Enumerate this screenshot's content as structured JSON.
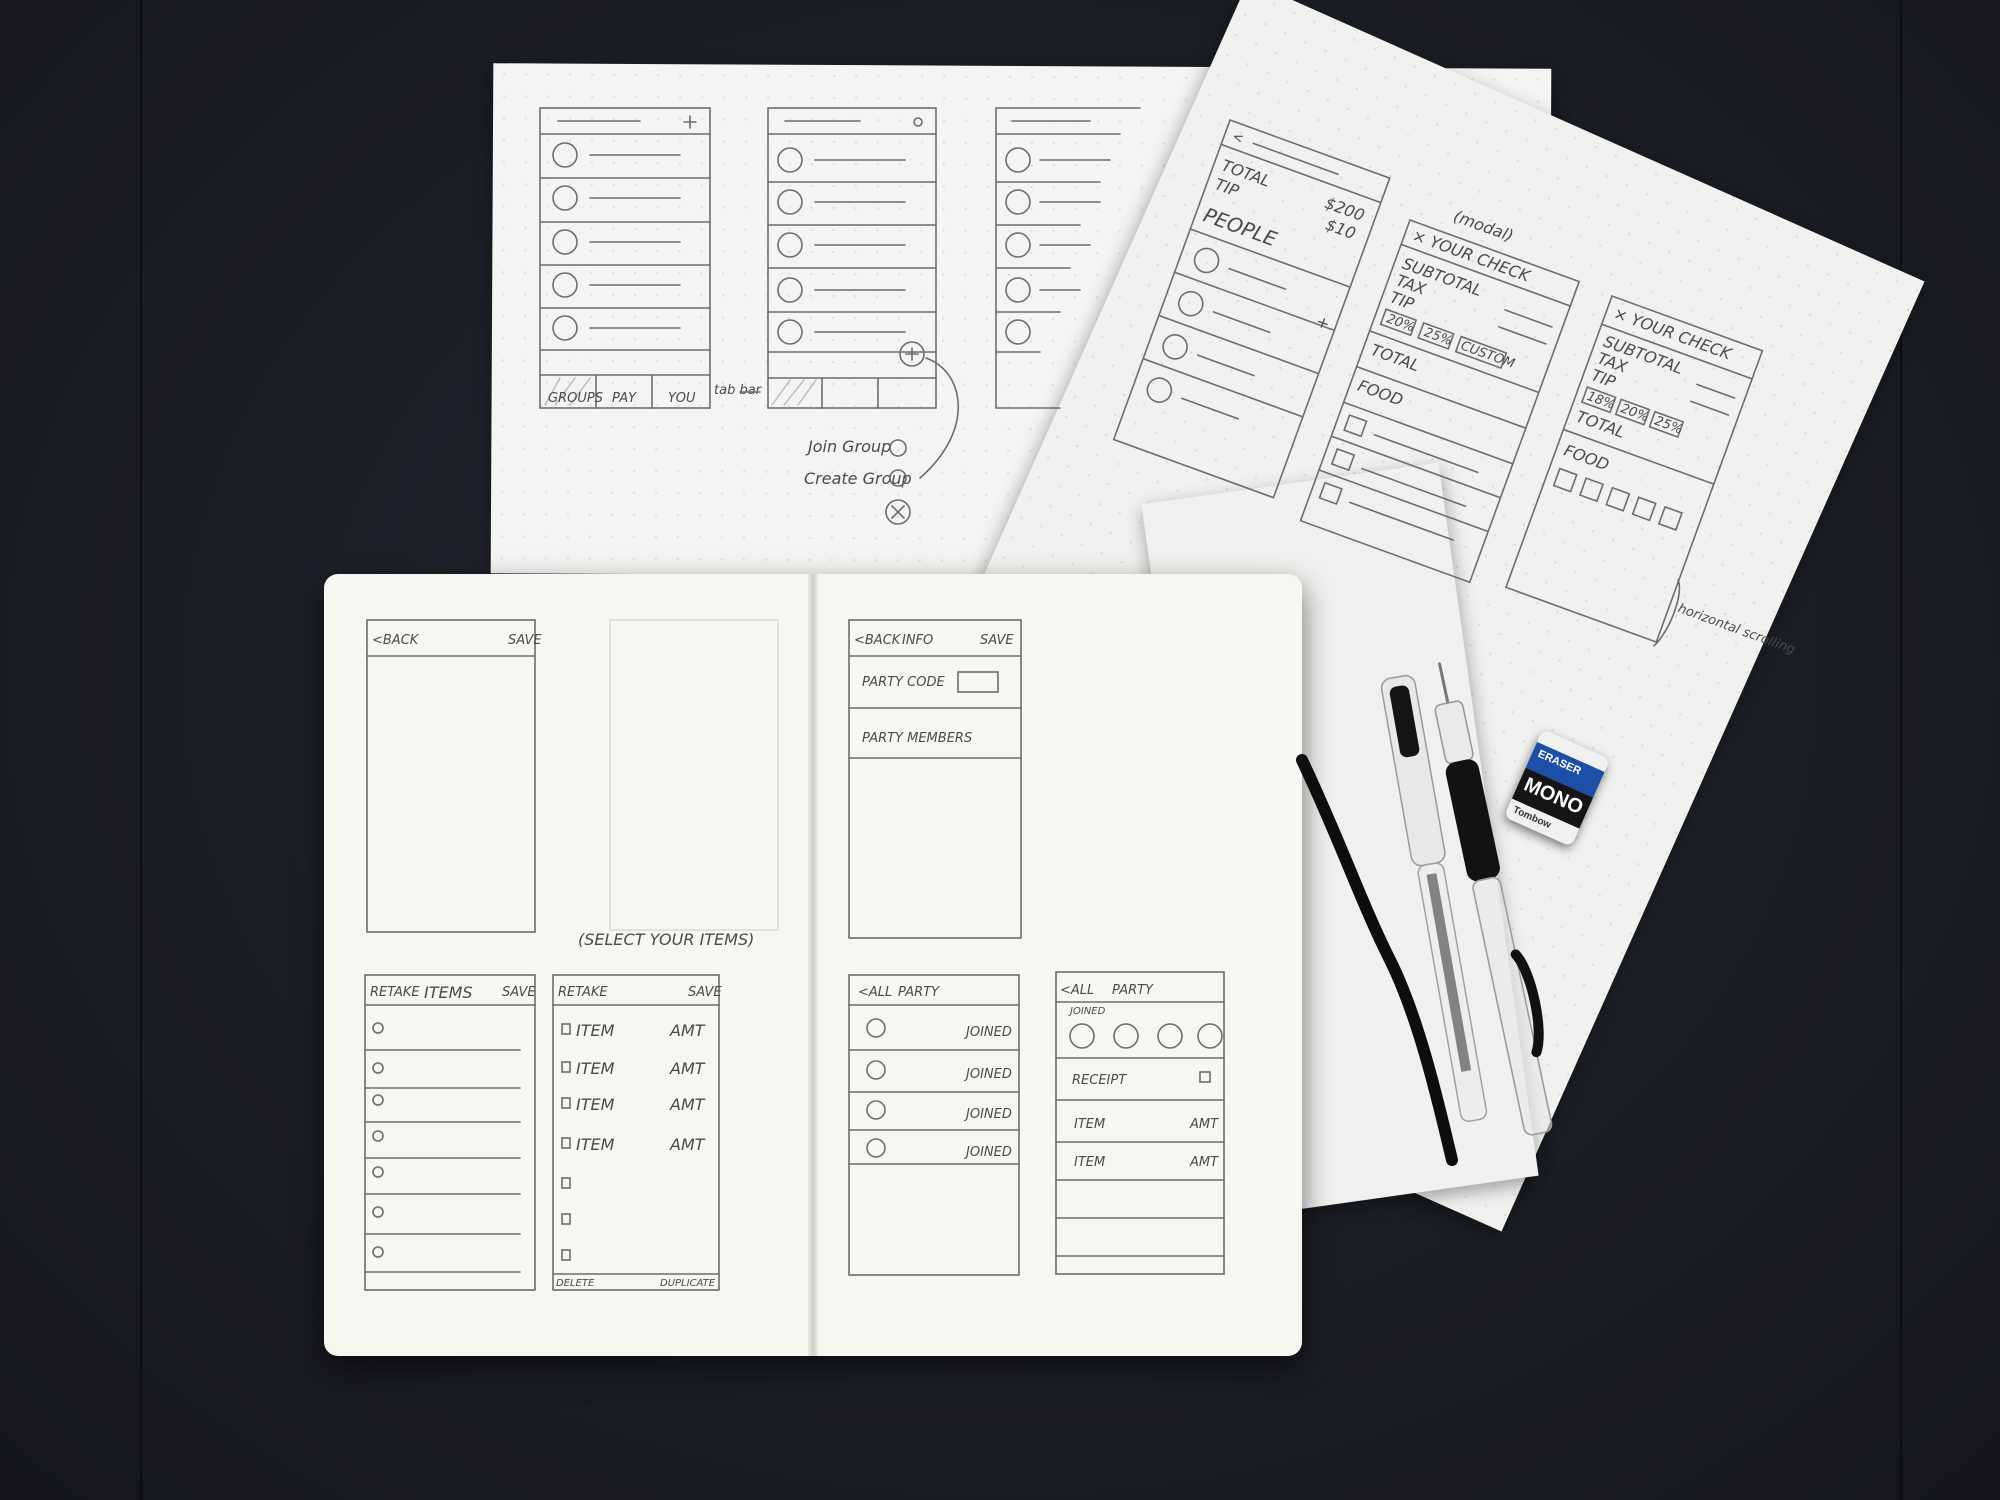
{
  "sheet_top": {
    "screen1_tabs": [
      "GROUPS",
      "PAY",
      "YOU"
    ],
    "tab_note": "tab bar",
    "menu_items": [
      "Join Group",
      "Create Group"
    ]
  },
  "sheet_right": {
    "labels": {
      "total": "TOTAL",
      "tip": "TIP",
      "people": "PEOPLE"
    },
    "values": [
      "$200",
      "$10"
    ],
    "modal_note": "(modal)",
    "check_title": "× YOUR CHECK",
    "check_fields": [
      "SUBTOTAL",
      "TAX",
      "TIP"
    ],
    "tip_options": [
      "20%",
      "25%",
      "CUSTOM"
    ],
    "total_label": "TOTAL",
    "food_label": "FOOD",
    "check2_title": "× YOUR CHECK",
    "check2_fields": [
      "SUBTOTAL",
      "TAX",
      "TIP"
    ],
    "check2_tips": [
      "18%",
      "20%",
      "25%"
    ],
    "check2_total": "TOTAL",
    "check2_food": "FOOD",
    "scroll_note": "horizontal scrolling"
  },
  "notebook": {
    "s1": {
      "back": "<BACK",
      "save": "SAVE"
    },
    "note": "(SELECT YOUR ITEMS)",
    "s2": {
      "left": "RETAKE",
      "title": "ITEMS",
      "right": "SAVE"
    },
    "s3": {
      "left": "RETAKE",
      "right": "SAVE",
      "rows": [
        [
          "ITEM",
          "AMT"
        ],
        [
          "ITEM",
          "AMT"
        ],
        [
          "ITEM",
          "AMT"
        ],
        [
          "ITEM",
          "AMT"
        ]
      ],
      "delete": "DELETE",
      "duplicate": "DUPLICATE"
    },
    "s4": {
      "back": "<BACK",
      "title": "INFO",
      "save": "SAVE",
      "code": "PARTY CODE",
      "members": "PARTY MEMBERS"
    },
    "s5": {
      "back": "<ALL",
      "title": "PARTY",
      "status": [
        "JOINED",
        "JOINED",
        "JOINED",
        "JOINED"
      ]
    },
    "s6": {
      "back": "<ALL",
      "title": "PARTY",
      "joined": "JOINED",
      "receipt": "RECEIPT",
      "rows": [
        [
          "ITEM",
          "AMT"
        ],
        [
          "ITEM",
          "AMT"
        ]
      ]
    }
  },
  "eraser": {
    "brand": "Tombow",
    "line1": "MONO",
    "line2": "ERASER"
  },
  "colors": {
    "table": "#1c1f24",
    "paper": "#f6f6f4",
    "notebook_page": "#f8f6f1",
    "pencil": "#6d6d6d",
    "eraser_blue": "#1e4fa8"
  }
}
